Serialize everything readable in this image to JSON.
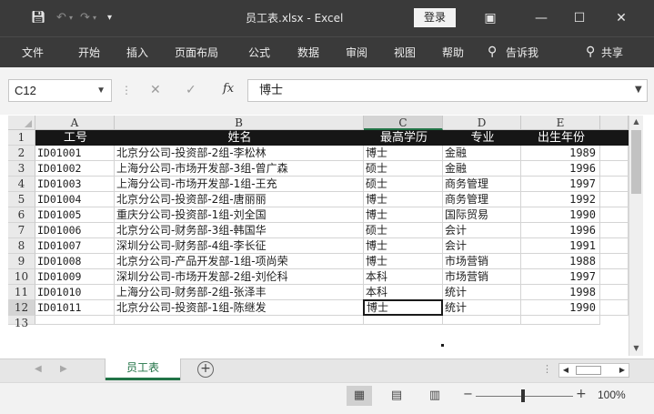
{
  "titlebar": {
    "title": "员工表.xlsx  -  Excel",
    "login_label": "登录",
    "icons": [
      "save-icon",
      "undo-icon",
      "redo-icon",
      "quick-access-dropdown-icon",
      "ribbon-display-icon",
      "minimize-icon",
      "maximize-icon",
      "close-icon"
    ]
  },
  "menu": {
    "items": [
      "文件",
      "开始",
      "插入",
      "页面布局",
      "公式",
      "数据",
      "审阅",
      "视图",
      "帮助"
    ],
    "tell_me": "告诉我",
    "share": "共享"
  },
  "formula_bar": {
    "name_box": "C12",
    "fx": "fx",
    "value": "博士"
  },
  "sheet": {
    "columns": [
      "A",
      "B",
      "C",
      "D",
      "E"
    ],
    "selected_column": "C",
    "row_numbers": [
      "1",
      "2",
      "3",
      "4",
      "5",
      "6",
      "7",
      "8",
      "9",
      "10",
      "11",
      "12",
      "13"
    ],
    "selected_row": "12",
    "header_row": [
      "工号",
      "姓名",
      "最高学历",
      "专业",
      "出生年份"
    ],
    "rows": [
      [
        "ID01001",
        "北京分公司-投资部-2组-李松林",
        "博士",
        "金融",
        "1989"
      ],
      [
        "ID01002",
        "上海分公司-市场开发部-3组-曾广森",
        "硕士",
        "金融",
        "1996"
      ],
      [
        "ID01003",
        "上海分公司-市场开发部-1组-王充",
        "硕士",
        "商务管理",
        "1997"
      ],
      [
        "ID01004",
        "北京分公司-投资部-2组-唐丽丽",
        "博士",
        "商务管理",
        "1992"
      ],
      [
        "ID01005",
        "重庆分公司-投资部-1组-刘全国",
        "博士",
        "国际贸易",
        "1990"
      ],
      [
        "ID01006",
        "北京分公司-财务部-3组-韩国华",
        "硕士",
        "会计",
        "1996"
      ],
      [
        "ID01007",
        "深圳分公司-财务部-4组-李长征",
        "博士",
        "会计",
        "1991"
      ],
      [
        "ID01008",
        "北京分公司-产品开发部-1组-项尚荣",
        "博士",
        "市场营销",
        "1988"
      ],
      [
        "ID01009",
        "深圳分公司-市场开发部-2组-刘伦科",
        "本科",
        "市场营销",
        "1997"
      ],
      [
        "ID01010",
        "上海分公司-财务部-2组-张泽丰",
        "本科",
        "统计",
        "1998"
      ],
      [
        "ID01011",
        "北京分公司-投资部-1组-陈继发",
        "博士",
        "统计",
        "1990"
      ]
    ]
  },
  "tabs": {
    "sheets": [
      "员工表"
    ],
    "active": "员工表",
    "add_label": "+"
  },
  "statusbar": {
    "zoom": "100%",
    "zoom_minus": "−",
    "zoom_plus": "+"
  },
  "colors": {
    "chrome": "#3a3a3a",
    "header_fill": "#161616",
    "header_text": "#ffffff",
    "accent": "#217346"
  }
}
